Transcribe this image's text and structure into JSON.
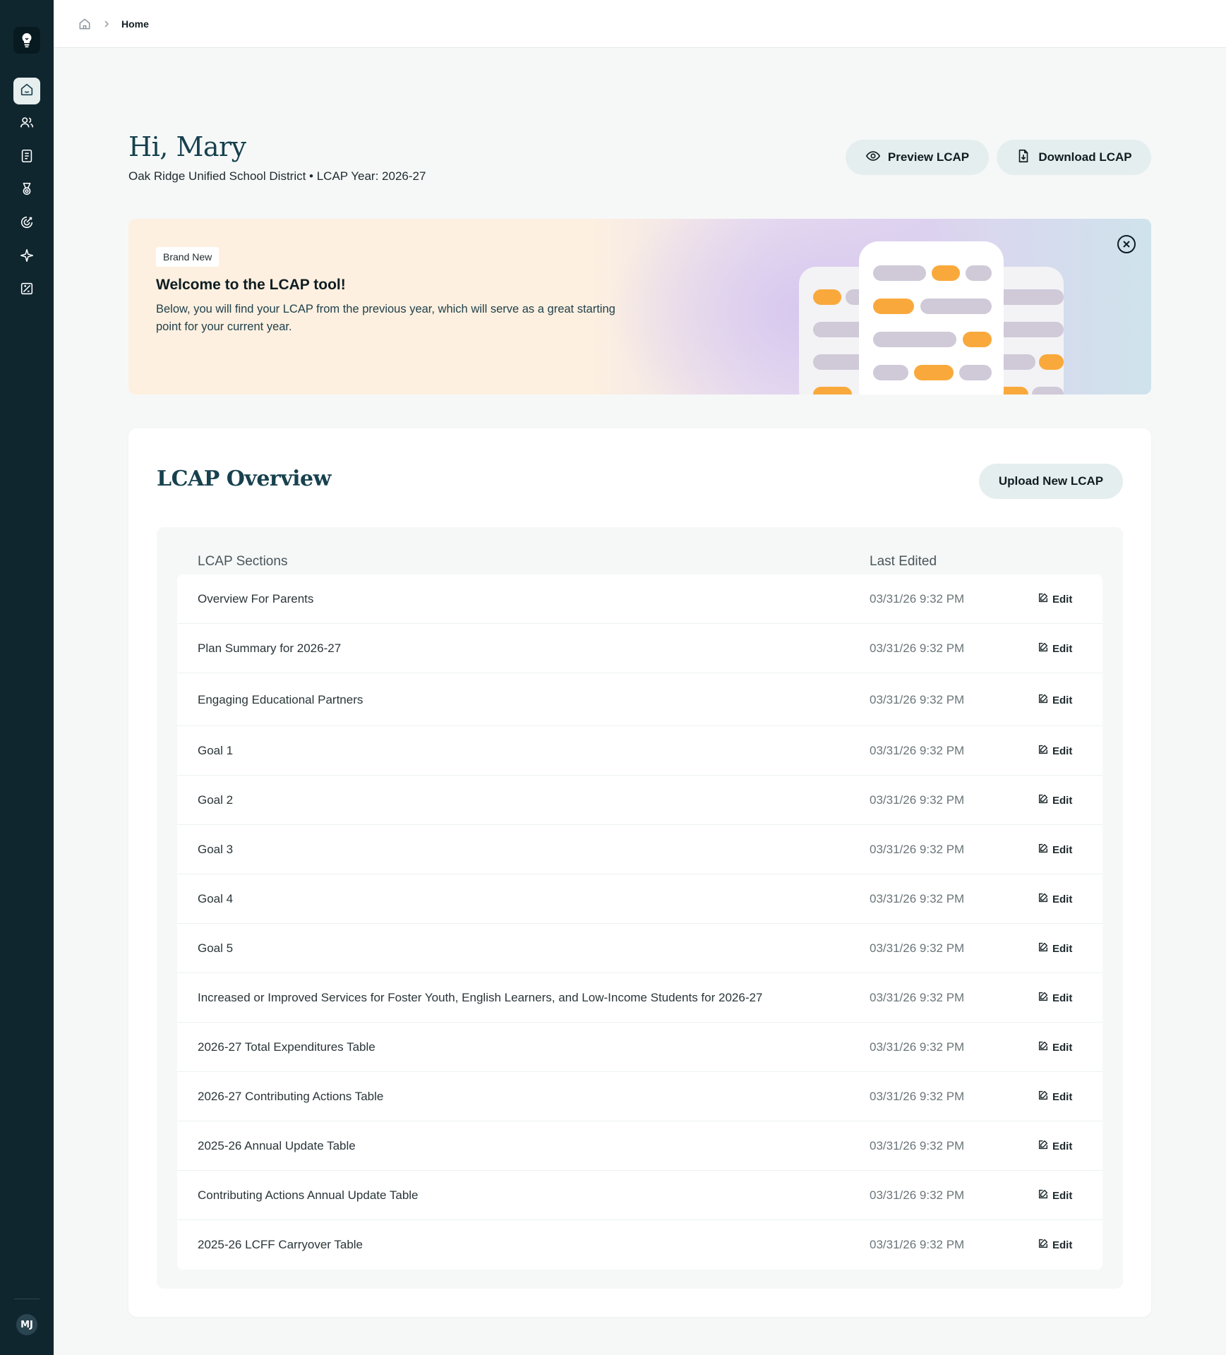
{
  "sidebar": {
    "logo": "lightbulb-icon",
    "items": [
      {
        "icon": "home-icon",
        "active": true
      },
      {
        "icon": "users-icon",
        "active": false
      },
      {
        "icon": "document-icon",
        "active": false
      },
      {
        "icon": "award-icon",
        "active": false
      },
      {
        "icon": "target-icon",
        "active": false
      },
      {
        "icon": "sparkle-icon",
        "active": false
      },
      {
        "icon": "calculator-icon",
        "active": false
      }
    ],
    "avatar_initials": "MJ"
  },
  "breadcrumb": {
    "home_icon": "home-icon",
    "current": "Home"
  },
  "header": {
    "greeting": "Hi, Mary",
    "subline": "Oak Ridge Unified School District • LCAP Year: 2026-27",
    "preview_label": "Preview LCAP",
    "download_label": "Download LCAP"
  },
  "banner": {
    "tag": "Brand New",
    "title": "Welcome to the LCAP tool!",
    "text": "Below, you will find your LCAP from the previous year, which will serve as a great starting point for your current year.",
    "accent_color": "#f9a93b",
    "bar_color": "#cfc9d8"
  },
  "overview": {
    "title": "LCAP Overview",
    "upload_label": "Upload New LCAP",
    "columns": {
      "section": "LCAP Sections",
      "edited": "Last Edited"
    },
    "edit_label": "Edit",
    "rows": [
      {
        "name": "Overview For Parents",
        "edited": "03/31/26 9:32 PM"
      },
      {
        "name": "Plan Summary for 2026-27",
        "edited": "03/31/26 9:32 PM"
      },
      {
        "name": "Engaging Educational Partners",
        "edited": "03/31/26 9:32 PM"
      },
      {
        "name": "Goal 1",
        "edited": "03/31/26 9:32 PM"
      },
      {
        "name": "Goal 2",
        "edited": "03/31/26 9:32 PM"
      },
      {
        "name": "Goal 3",
        "edited": "03/31/26 9:32 PM"
      },
      {
        "name": "Goal 4",
        "edited": "03/31/26 9:32 PM"
      },
      {
        "name": "Goal 5",
        "edited": "03/31/26 9:32 PM"
      },
      {
        "name": "Increased or Improved Services for Foster Youth, English Learners, and Low-Income Students for 2026-27",
        "edited": "03/31/26 9:32 PM"
      },
      {
        "name": "2026-27 Total Expenditures Table",
        "edited": "03/31/26 9:32 PM"
      },
      {
        "name": "2026-27 Contributing Actions Table",
        "edited": "03/31/26 9:32 PM"
      },
      {
        "name": "2025-26 Annual Update Table",
        "edited": "03/31/26 9:32 PM"
      },
      {
        "name": "Contributing Actions Annual Update Table",
        "edited": "03/31/26 9:32 PM"
      },
      {
        "name": "2025-26 LCFF Carryover Table",
        "edited": "03/31/26 9:32 PM"
      }
    ]
  }
}
